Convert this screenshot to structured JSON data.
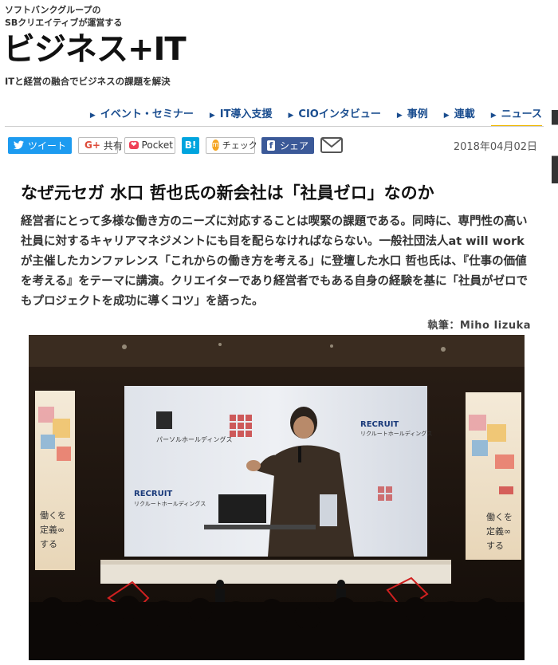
{
  "header": {
    "tagline_1": "ソフトバンクグループの",
    "tagline_2": "SBクリエイティブが運営する",
    "logo": "ビジネス+IT",
    "subtitle": "ITと経営の融合でビジネスの課題を解決"
  },
  "nav": {
    "items": [
      {
        "label": "イベント・セミナー"
      },
      {
        "label": "IT導入支援"
      },
      {
        "label": "CIOインタビュー"
      },
      {
        "label": "事例"
      },
      {
        "label": "連載"
      },
      {
        "label": "ニュース"
      }
    ],
    "active": "ニュース"
  },
  "share": {
    "tweet": "ツイート",
    "gplus": "共有",
    "pocket": "Pocket",
    "hatena": "B!",
    "check": "チェック",
    "facebook": "シェア"
  },
  "article": {
    "date": "2018年04月02日",
    "title": "なぜ元セガ 水口 哲也氏の新会社は「社員ゼロ」なのか",
    "lead": "経営者にとって多様な働き方のニーズに対応することは喫緊の課題である。同時に、専門性の高い社員に対するキャリアマネジメントにも目を配らなければならない。一般社団法人at will workが主催したカンファレンス「これからの働き方を考える」に登壇した水口 哲也氏は、『仕事の価値を考える』をテーマに講演。クリエイターであり経営者でもある自身の経験を基に「社員がゼロでもプロジェクトを成功に導くコツ」を語った。",
    "author": "執筆：Miho Iizuka"
  },
  "photo": {
    "screen_logo_left": "パーソルホールディングス",
    "screen_logo_recruit": "RECRUIT",
    "screen_logo_recruit_sub": "リクルートホールディングス",
    "banner_text_1": "働くを",
    "banner_text_2": "定義∞",
    "banner_text_3": "する"
  },
  "colors": {
    "nav": "#1a4d8f",
    "nav_active_underline": "#f0b800",
    "twitter": "#1d9bf0",
    "facebook": "#3b5998",
    "hatena": "#00a4de"
  }
}
